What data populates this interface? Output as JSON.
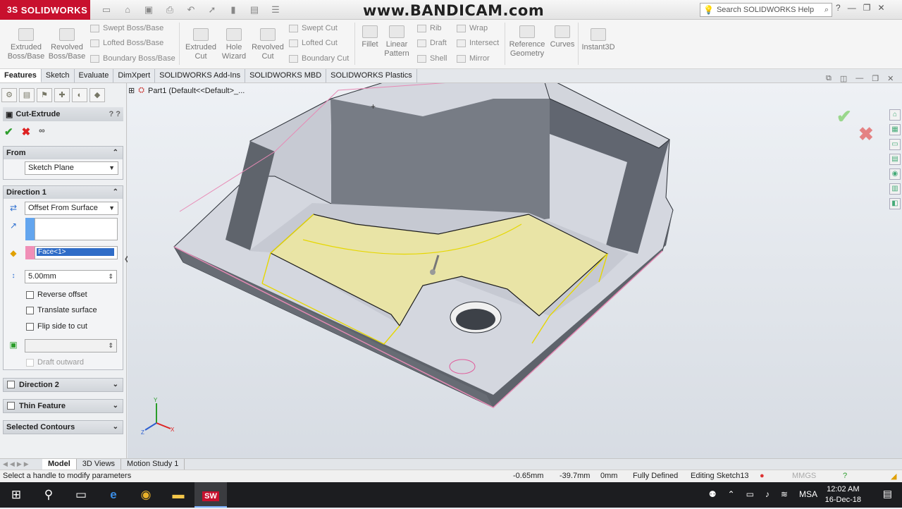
{
  "app": {
    "logo_ds": "3S",
    "logo_name": "SOLIDWORKS",
    "watermark": "www.BANDICAM.com",
    "search_placeholder": "Search SOLIDWORKS Help"
  },
  "ribbon": {
    "extruded_boss": "Extruded Boss/Base",
    "revolved_boss": "Revolved Boss/Base",
    "swept_boss": "Swept Boss/Base",
    "lofted_boss": "Lofted Boss/Base",
    "boundary_boss": "Boundary Boss/Base",
    "extruded_cut": "Extruded Cut",
    "hole_wizard": "Hole Wizard",
    "revolved_cut": "Revolved Cut",
    "swept_cut": "Swept Cut",
    "lofted_cut": "Lofted Cut",
    "boundary_cut": "Boundary Cut",
    "fillet": "Fillet",
    "linear_pattern": "Linear Pattern",
    "rib": "Rib",
    "draft": "Draft",
    "shell": "Shell",
    "wrap": "Wrap",
    "intersect": "Intersect",
    "mirror": "Mirror",
    "reference_geometry": "Reference Geometry",
    "curves": "Curves",
    "instant3d": "Instant3D"
  },
  "tabs": [
    "Features",
    "Sketch",
    "Evaluate",
    "DimXpert",
    "SOLIDWORKS Add-Ins",
    "SOLIDWORKS MBD",
    "SOLIDWORKS Plastics"
  ],
  "property_manager": {
    "title": "Cut-Extrude",
    "from_header": "From",
    "from_value": "Sketch Plane",
    "dir1_header": "Direction 1",
    "end_condition": "Offset From Surface",
    "face_selection": "Face<1>",
    "offset_value": "5.00mm",
    "reverse_offset": "Reverse offset",
    "translate_surface": "Translate surface",
    "flip_side": "Flip side to cut",
    "draft_outward": "Draft outward",
    "dir2_header": "Direction 2",
    "thin_feature": "Thin Feature",
    "selected_contours": "Selected Contours"
  },
  "viewport": {
    "tree_path": "Part1  (Default<<Default>_..."
  },
  "bottom_tabs": [
    "Model",
    "3D Views",
    "Motion Study 1"
  ],
  "status": {
    "hint": "Select a handle to modify parameters",
    "x": "-0.65mm",
    "y": "-39.7mm",
    "z": "0mm",
    "state": "Fully Defined",
    "editing": "Editing Sketch13",
    "units": "MMGS"
  },
  "taskbar": {
    "lang": "MSA",
    "time": "12:02 AM",
    "date": "16-Dec-18"
  }
}
